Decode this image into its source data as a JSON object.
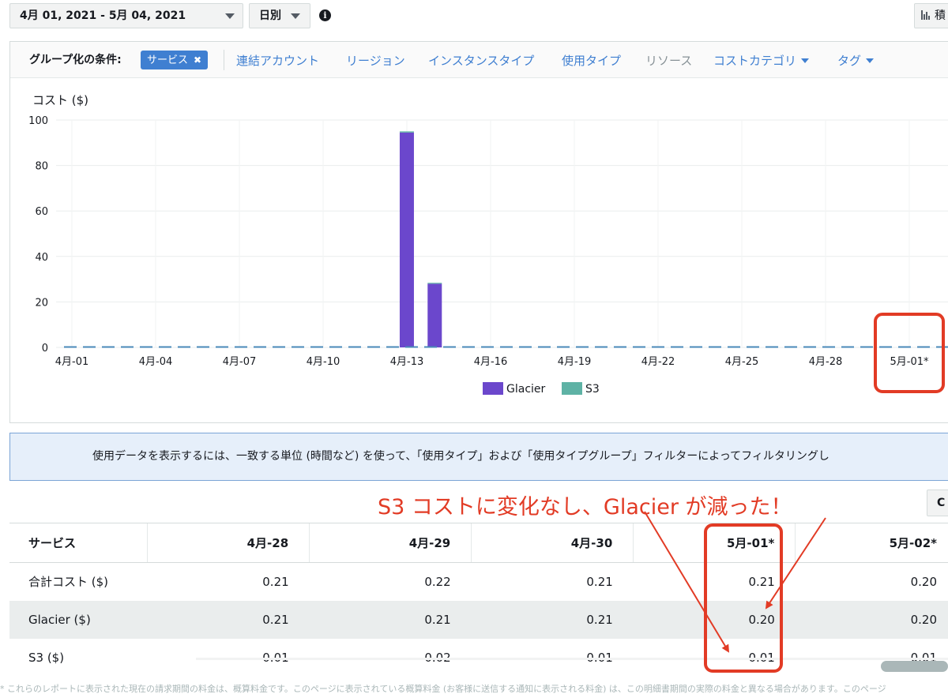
{
  "toolbar": {
    "date_range": "4月 01, 2021 - 5月 04, 2021",
    "granularity": "日別",
    "info_icon": "info-icon",
    "chart_type_button": "積"
  },
  "group_by": {
    "label": "グループ化の条件:",
    "selected_chip": "サービス",
    "options": [
      {
        "label": "連結アカウント",
        "enabled": true,
        "dropdown": false
      },
      {
        "label": "リージョン",
        "enabled": true,
        "dropdown": false
      },
      {
        "label": "インスタンスタイプ",
        "enabled": true,
        "dropdown": false
      },
      {
        "label": "使用タイプ",
        "enabled": true,
        "dropdown": false
      },
      {
        "label": "リソース",
        "enabled": false,
        "dropdown": false
      },
      {
        "label": "コストカテゴリ",
        "enabled": true,
        "dropdown": true
      },
      {
        "label": "タグ",
        "enabled": true,
        "dropdown": true
      }
    ]
  },
  "chart_data": {
    "type": "bar",
    "stacked": true,
    "ylabel": "コスト ($)",
    "ylim": [
      0,
      100
    ],
    "yticks": [
      0,
      20,
      40,
      60,
      80,
      100
    ],
    "x_tick_labels": [
      "4月-01",
      "4月-04",
      "4月-07",
      "4月-10",
      "4月-13",
      "4月-16",
      "4月-19",
      "4月-22",
      "4月-25",
      "4月-28",
      "5月-01*"
    ],
    "categories": [
      "4月-01",
      "4月-02",
      "4月-03",
      "4月-04",
      "4月-05",
      "4月-06",
      "4月-07",
      "4月-08",
      "4月-09",
      "4月-10",
      "4月-11",
      "4月-12",
      "4月-13",
      "4月-14",
      "4月-15",
      "4月-16",
      "4月-17",
      "4月-18",
      "4月-19",
      "4月-20",
      "4月-21",
      "4月-22",
      "4月-23",
      "4月-24",
      "4月-25",
      "4月-26",
      "4月-27",
      "4月-28",
      "4月-29",
      "4月-30",
      "5月-01*",
      "5月-02*"
    ],
    "series": [
      {
        "name": "Glacier",
        "color": "#6b47cc",
        "values": [
          0.2,
          0.2,
          0.2,
          0.2,
          0.2,
          0.2,
          0.2,
          0.2,
          0.2,
          0.2,
          0.2,
          0.2,
          94.5,
          28.0,
          0.2,
          0.2,
          0.2,
          0.2,
          0.2,
          0.2,
          0.2,
          0.2,
          0.2,
          0.2,
          0.2,
          0.2,
          0.2,
          0.21,
          0.21,
          0.21,
          0.2,
          0.2
        ]
      },
      {
        "name": "S3",
        "color": "#5eb2a5",
        "values": [
          0.01,
          0.01,
          0.01,
          0.01,
          0.01,
          0.01,
          0.01,
          0.01,
          0.01,
          0.01,
          0.01,
          0.01,
          0.5,
          0.4,
          0.01,
          0.01,
          0.01,
          0.01,
          0.01,
          0.01,
          0.01,
          0.01,
          0.01,
          0.01,
          0.01,
          0.01,
          0.01,
          0.01,
          0.01,
          0.01,
          0.01,
          0.01
        ]
      }
    ],
    "grid": true,
    "legend": "bottom-center"
  },
  "banner": {
    "text": "使用データを表示するには、一致する単位 (時間など) を使って、「使用タイプ」および「使用タイプグループ」フィルターによってフィルタリングし"
  },
  "annotation": {
    "text": "S3 コストに変化なし、Glacier が減った！",
    "color": "#e23b25"
  },
  "csv_button": "C",
  "table": {
    "headers": [
      "サービス",
      "4月-28",
      "4月-29",
      "4月-30",
      "5月-01*",
      "5月-02*"
    ],
    "rows": [
      {
        "label": "合計コスト ($)",
        "values": [
          "0.21",
          "0.22",
          "0.21",
          "0.21",
          "0.20"
        ],
        "shaded": false
      },
      {
        "label": "Glacier ($)",
        "values": [
          "0.21",
          "0.21",
          "0.21",
          "0.20",
          "0.20"
        ],
        "shaded": true
      },
      {
        "label": "S3 ($)",
        "values": [
          "0.01",
          "0.02",
          "0.01",
          "0.01",
          "0.01"
        ],
        "shaded": false
      }
    ]
  },
  "footnote": "* これらのレポートに表示された現在の請求期間の料金は、概算料金です。このページに表示されている概算料金 (お客様に送信する通知に表示される料金) は、この明細書期間の実際の料金と異なる場合があります。このページ"
}
